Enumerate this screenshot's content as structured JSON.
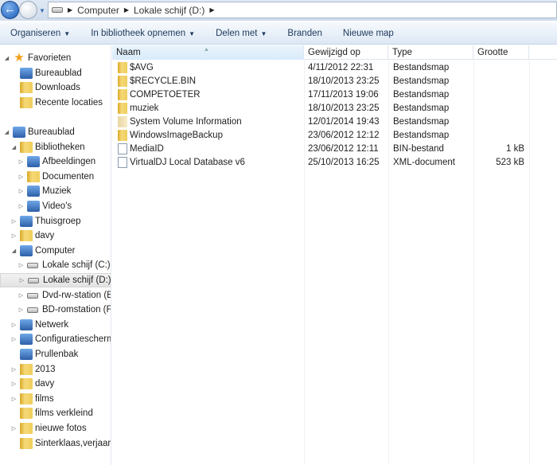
{
  "breadcrumb": [
    "Computer",
    "Lokale schijf (D:)"
  ],
  "toolbar": [
    {
      "label": "Organiseren",
      "dropdown": true
    },
    {
      "label": "In bibliotheek opnemen",
      "dropdown": true
    },
    {
      "label": "Delen met",
      "dropdown": true
    },
    {
      "label": "Branden",
      "dropdown": false
    },
    {
      "label": "Nieuwe map",
      "dropdown": false
    }
  ],
  "columns": [
    "Naam",
    "Gewijzigd op",
    "Type",
    "Grootte"
  ],
  "files": [
    {
      "name": "$AVG",
      "date": "4/11/2012 22:31",
      "type": "Bestandsmap",
      "size": "",
      "icon": "folder"
    },
    {
      "name": "$RECYCLE.BIN",
      "date": "18/10/2013 23:25",
      "type": "Bestandsmap",
      "size": "",
      "icon": "folder"
    },
    {
      "name": "COMPETOETER",
      "date": "17/11/2013 19:06",
      "type": "Bestandsmap",
      "size": "",
      "icon": "shared-folder"
    },
    {
      "name": "muziek",
      "date": "18/10/2013 23:25",
      "type": "Bestandsmap",
      "size": "",
      "icon": "folder"
    },
    {
      "name": "System Volume Information",
      "date": "12/01/2014 19:43",
      "type": "Bestandsmap",
      "size": "",
      "icon": "hidden-folder"
    },
    {
      "name": "WindowsImageBackup",
      "date": "23/06/2012 12:12",
      "type": "Bestandsmap",
      "size": "",
      "icon": "folder"
    },
    {
      "name": "MediaID",
      "date": "23/06/2012 12:11",
      "type": "BIN-bestand",
      "size": "1 kB",
      "icon": "file"
    },
    {
      "name": "VirtualDJ Local Database v6",
      "date": "25/10/2013 16:25",
      "type": "XML-document",
      "size": "523 kB",
      "icon": "xml-file"
    }
  ],
  "tree": [
    {
      "label": "Favorieten",
      "indent": 0,
      "exp": "open",
      "icon": "star"
    },
    {
      "label": "Bureaublad",
      "indent": 1,
      "exp": "",
      "icon": "blue"
    },
    {
      "label": "Downloads",
      "indent": 1,
      "exp": "",
      "icon": "folder"
    },
    {
      "label": "Recente locaties",
      "indent": 1,
      "exp": "",
      "icon": "folder"
    },
    {
      "label": "",
      "indent": 0,
      "exp": "",
      "icon": "none"
    },
    {
      "label": "Bureaublad",
      "indent": 0,
      "exp": "open",
      "icon": "blue"
    },
    {
      "label": "Bibliotheken",
      "indent": 1,
      "exp": "open",
      "icon": "folder"
    },
    {
      "label": "Afbeeldingen",
      "indent": 2,
      "exp": "closed",
      "icon": "blue"
    },
    {
      "label": "Documenten",
      "indent": 2,
      "exp": "closed",
      "icon": "folder"
    },
    {
      "label": "Muziek",
      "indent": 2,
      "exp": "closed",
      "icon": "blue"
    },
    {
      "label": "Video's",
      "indent": 2,
      "exp": "closed",
      "icon": "blue"
    },
    {
      "label": "Thuisgroep",
      "indent": 1,
      "exp": "closed",
      "icon": "blue"
    },
    {
      "label": "davy",
      "indent": 1,
      "exp": "closed",
      "icon": "folder"
    },
    {
      "label": "Computer",
      "indent": 1,
      "exp": "open",
      "icon": "blue"
    },
    {
      "label": "Lokale schijf (C:)",
      "indent": 2,
      "exp": "closed",
      "icon": "drive"
    },
    {
      "label": "Lokale schijf (D:)",
      "indent": 2,
      "exp": "closed",
      "icon": "drive",
      "selected": true
    },
    {
      "label": "Dvd-rw-station (E:)",
      "indent": 2,
      "exp": "closed",
      "icon": "drive"
    },
    {
      "label": "BD-romstation (F:)",
      "indent": 2,
      "exp": "closed",
      "icon": "drive"
    },
    {
      "label": "Netwerk",
      "indent": 1,
      "exp": "closed",
      "icon": "blue"
    },
    {
      "label": "Configuratiescherm",
      "indent": 1,
      "exp": "closed",
      "icon": "blue"
    },
    {
      "label": "Prullenbak",
      "indent": 1,
      "exp": "",
      "icon": "blue"
    },
    {
      "label": "2013",
      "indent": 1,
      "exp": "closed",
      "icon": "folder"
    },
    {
      "label": "davy",
      "indent": 1,
      "exp": "closed",
      "icon": "folder"
    },
    {
      "label": "films",
      "indent": 1,
      "exp": "closed",
      "icon": "folder"
    },
    {
      "label": "films verkleind",
      "indent": 1,
      "exp": "",
      "icon": "folder"
    },
    {
      "label": "nieuwe fotos",
      "indent": 1,
      "exp": "closed",
      "icon": "folder"
    },
    {
      "label": "Sinterklaas,verjaarda",
      "indent": 1,
      "exp": "",
      "icon": "folder"
    }
  ]
}
